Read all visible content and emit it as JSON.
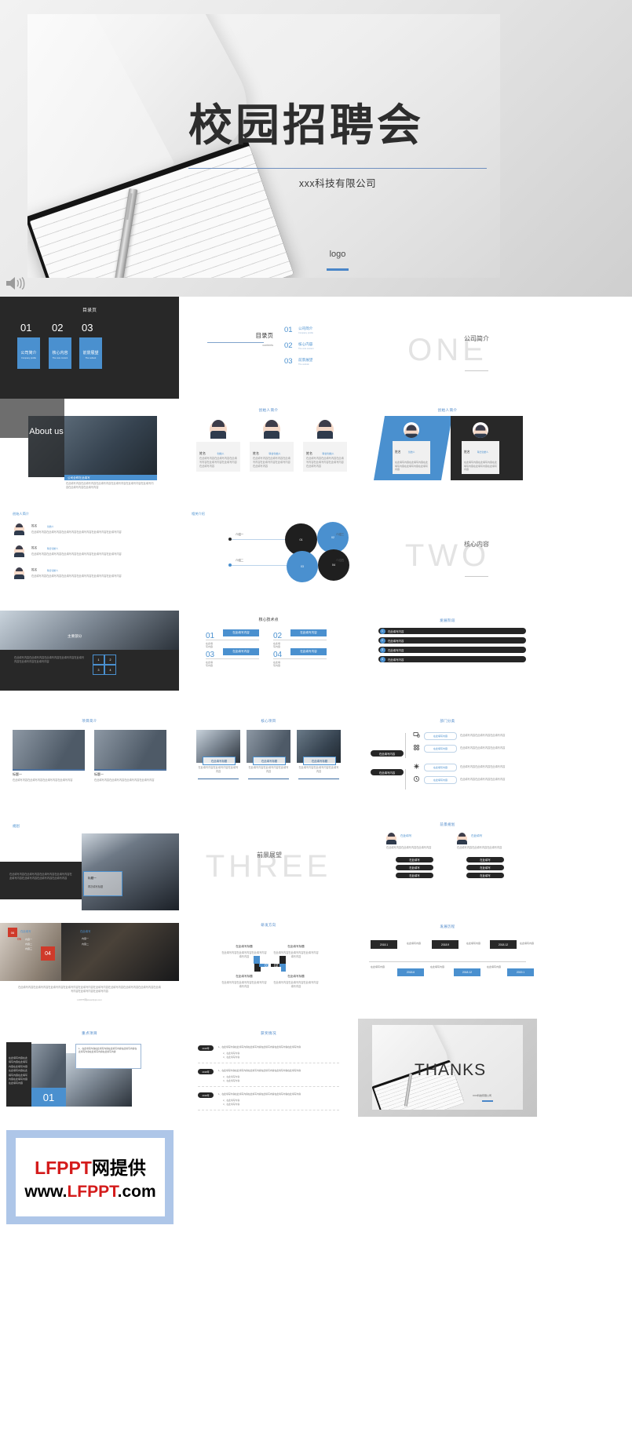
{
  "hero": {
    "title": "校园招聘会",
    "subtitle": "xxx科技有限公司",
    "logo": "logo",
    "speaker_icon": "speaker-icon"
  },
  "slides": {
    "toc_dark": {
      "header": "目录页",
      "items": [
        {
          "num": "01",
          "cn": "公司简介",
          "en": "Company profile"
        },
        {
          "num": "02",
          "cn": "核心内容",
          "en": "The core content"
        },
        {
          "num": "03",
          "cn": "前景展望",
          "en": "The outlook"
        }
      ]
    },
    "toc_light": {
      "title": "目录页",
      "subtitle": "contents",
      "items": [
        {
          "num": "01",
          "cn": "公司简介",
          "en": "Company profile"
        },
        {
          "num": "02",
          "cn": "核心内容",
          "en": "The core content"
        },
        {
          "num": "03",
          "cn": "前景展望",
          "en": "The outlook"
        }
      ]
    },
    "section_one": {
      "title": "公司简介",
      "watermark": "ONE"
    },
    "about_us": {
      "label": "About us",
      "caption_title": "公司全称在此填写",
      "caption_body": "在此填写内容在此填写内容在此填写内容在此填写内容在此填写内容在此填写内容在此填写内容在此填写内容"
    },
    "founders_3": {
      "title": "创始人简介",
      "cards": [
        {
          "name": "姓名",
          "role": "创始人",
          "body": "在此填写内容在此填写内容在此填写内容在此填写内容在此填写内容在此填写内容"
        },
        {
          "name": "姓名",
          "role": "联合创始人",
          "body": "在此填写内容在此填写内容在此填写内容在此填写内容在此填写内容在此填写内容"
        },
        {
          "name": "姓名",
          "role": "联合创始人",
          "body": "在此填写内容在此填写内容在此填写内容在此填写内容在此填写内容在此填写内容"
        }
      ]
    },
    "founders_2": {
      "title": "创始人简介",
      "cards": [
        {
          "name": "姓名",
          "role": "创始人",
          "body": "在此填写内容在此填写内容在此填写内容在此填写内容在此填写内容"
        },
        {
          "name": "姓名",
          "role": "联合创始人",
          "body": "在此填写内容在此填写内容在此填写内容在此填写内容在此填写内容"
        }
      ]
    },
    "founders_list": {
      "title": "创始人简介",
      "rows": [
        {
          "name": "姓名",
          "role": "创始人",
          "body": "在此填写内容在此填写内容在此填写内容在此填写内容在此填写内容在此填写内容"
        },
        {
          "name": "姓名",
          "role": "联合创始人",
          "body": "在此填写内容在此填写内容在此填写内容在此填写内容在此填写内容在此填写内容"
        },
        {
          "name": "姓名",
          "role": "联合创始人",
          "body": "在此填写内容在此填写内容在此填写内容在此填写内容在此填写内容在此填写内容"
        }
      ]
    },
    "related_intro": {
      "title": "相关介绍",
      "circles": [
        "01",
        "02",
        "03",
        "04"
      ],
      "labels": [
        "介绍一",
        "介绍二",
        "介绍三",
        "介绍四"
      ]
    },
    "section_two": {
      "title": "核心内容",
      "watermark": "TWO"
    },
    "main_part": {
      "title": "主要部分",
      "cells": [
        "1",
        "2",
        "3",
        "4"
      ],
      "body": "在此填写内容在此填写内容在此填写内容在此填写内容在此填写内容在此填写内容在此填写内容"
    },
    "core_tech": {
      "title": "核心技术点",
      "items": [
        {
          "num": "01",
          "bar": "在此填写内容",
          "sub": "在此填写内容"
        },
        {
          "num": "02",
          "bar": "在此填写内容",
          "sub": "在此填写内容"
        },
        {
          "num": "03",
          "bar": "在此填写内容",
          "sub": "在此填写内容"
        },
        {
          "num": "04",
          "bar": "在此填写内容",
          "sub": "在此填写内容"
        }
      ]
    },
    "dev_stage": {
      "title": "发展阶段",
      "rows": [
        {
          "num": "1",
          "text": "在此填写内容"
        },
        {
          "num": "2",
          "text": "在此填写内容"
        },
        {
          "num": "3",
          "text": "在此填写内容"
        },
        {
          "num": "4",
          "text": "在此填写内容"
        }
      ]
    },
    "project_intro": {
      "title": "项目简介",
      "cards": [
        {
          "title": "标题一",
          "body": "在此填写内容在此填写内容在此填写内容在此填写内容"
        },
        {
          "title": "标题一",
          "body": "在此填写内容在此填写内容在此填写内容在此填写内容"
        }
      ]
    },
    "core_projects": {
      "title": "核心项目",
      "cards": [
        {
          "cap": "在此填写标题",
          "body": "在此填写内容在此填写内容在此填写内容"
        },
        {
          "cap": "在此填写标题",
          "body": "在此填写内容在此填写内容在此填写内容"
        },
        {
          "cap": "在此填写标题",
          "body": "在此填写内容在此填写内容在此填写内容"
        }
      ]
    },
    "dept_class": {
      "title": "部门分类",
      "roots": [
        "在此填写内容",
        "在此填写内容"
      ],
      "branches": [
        {
          "icon": "monitor-icon",
          "label": "在此填写内容",
          "desc": "在此填写内容在此填写内容在此填写内容"
        },
        {
          "icon": "grid-icon",
          "label": "在此填写内容",
          "desc": "在此填写内容在此填写内容在此填写内容"
        },
        {
          "icon": "gear-icon",
          "label": "在此填写内容",
          "desc": "在此填写内容在此填写内容在此填写内容"
        },
        {
          "icon": "clock-icon",
          "label": "在此填写内容",
          "desc": "在此填写内容在此填写内容在此填写内容"
        }
      ]
    },
    "planning": {
      "title": "规划",
      "body": "在此填写内容在此填写内容在此填写内容在此填写内容在此填写内容在此填写内容在此填写内容在此填写内容",
      "card_title": "标题一",
      "card_sub": "再次填写标题"
    },
    "section_three": {
      "title": "前景展望",
      "watermark": "THREE"
    },
    "future_plan": {
      "title": "前景规划",
      "cols": [
        {
          "head": "在此填写",
          "sub": "在此填写内容在此填写内容在此填写内容",
          "pills": [
            "在此填写",
            "在此填写",
            "在此填写"
          ]
        },
        {
          "head": "在此填写",
          "sub": "在此填写内容在此填写内容在此填写内容",
          "pills": [
            "在此填写",
            "在此填写",
            "在此填写"
          ]
        }
      ]
    },
    "dev_type": {
      "title": "发展类别",
      "badges": [
        "06",
        "05",
        "04"
      ],
      "label": "在此填写",
      "bullets": [
        "内容一",
        "内容二",
        "内容三"
      ],
      "footer": "在此填写内容在此填写内容在此填写内容在此填写内容在此填写内容在此填写内容在此填写内容在此填写内容在此填写内容在此填写内容在此填写内容在此填写内容",
      "source": "LFPPT网www.lfppt.com"
    },
    "research_dir": {
      "title": "研发方向",
      "quads": [
        {
          "num": "01",
          "title": "在此填写标题",
          "body": "在此填写内容在此填写内容在此填写内容填写内容"
        },
        {
          "num": "02",
          "title": "在此填写标题",
          "body": "在此填写内容在此填写内容在此填写内容填写内容"
        },
        {
          "num": "03",
          "title": "在此填写标题",
          "body": "在此填写内容在此填写内容在此填写内容填写内容"
        },
        {
          "num": "04",
          "title": "在此填写标题",
          "body": "在此填写内容在此填写内容在此填写内容填写内容"
        }
      ]
    },
    "dev_history": {
      "title": "发展历程",
      "top": [
        {
          "date": "2018.1",
          "text": "在此填写内容"
        },
        {
          "date": "2018.9",
          "text": "在此填写内容"
        },
        {
          "date": "2018.12",
          "text": "在此填写内容"
        }
      ],
      "bottom": [
        {
          "date": "2018.6",
          "text": "在此填写内容"
        },
        {
          "date": "2018.12",
          "text": "在此填写内容"
        },
        {
          "date": "2019.1",
          "text": "在此填写内容"
        }
      ]
    },
    "key_project": {
      "title": "重点项目",
      "num": "01",
      "left_body": "在此填写内容在此填写内容在此填写内容在此填写内容在此填写内容在此填写内容在此填写内容在此填写内容在此填写内容",
      "note": "1、在此填写内容在此填写内容在此填写内容在此填写内容在此填写内容在此填写内容在此填写内容"
    },
    "awards": {
      "title": "获奖情况",
      "rows": [
        {
          "date": "2018年",
          "body": "1、在此填写内容在此填写内容在此填写内容在此填写内容在此填写内容在此填写内容",
          "subs": [
            "2、在此填写内容",
            "3、在此填写内容"
          ]
        },
        {
          "date": "2018年",
          "body": "1、在此填写内容在此填写内容在此填写内容在此填写内容在此填写内容在此填写内容",
          "subs": [
            "2、在此填写内容",
            "3、在此填写内容"
          ]
        },
        {
          "date": "2018年",
          "body": "1、在此填写内容在此填写内容在此填写内容在此填写内容在此填写内容在此填写内容",
          "subs": [
            "2、在此填写内容",
            "3、在此填写内容"
          ]
        }
      ]
    },
    "thanks": {
      "text": "THANKS",
      "sub": "XXX科技有限公司"
    }
  },
  "watermark": {
    "line1_cn": "网提供",
    "line1_brand": "LFPPT",
    "line2_prefix": "www.",
    "line2_brand": "LFPPT",
    "line2_suffix": ".com"
  },
  "colors": {
    "accent": "#4a90cf",
    "dark": "#282828",
    "muted": "#8e8e8e"
  }
}
